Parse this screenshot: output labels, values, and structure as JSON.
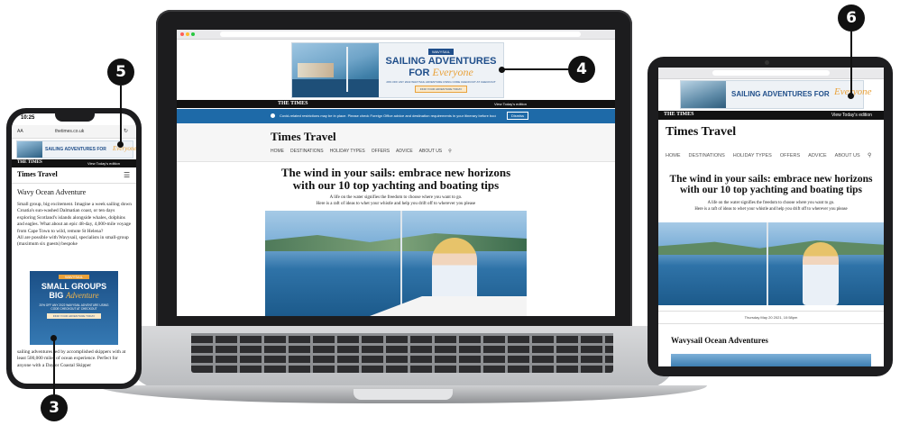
{
  "callouts": {
    "c3": "3",
    "c4": "4",
    "c5": "5",
    "c6": "6"
  },
  "ad": {
    "title_line1": "SAILING ADVENTURES",
    "title_line2_a": "FOR",
    "title_line2_b": "Everyone",
    "brand": "WAVYSAIL",
    "promo": "20% OFF ANY 2022 WAVYSAIL ADVENTURE USING CODE CHECKOUT AT CHECKOUT",
    "cta": "FIND YOUR ADVENTURE TODAY"
  },
  "site": {
    "masthead": "THE TIMES",
    "todays_edition": "View Today's edition",
    "notice": "Covid-related restrictions may be in place. Please check Foreign Office advice and destination requirements in your itinerary before booking.",
    "dismiss": "Dismiss",
    "section_title": "Times Travel",
    "nav": [
      "HOME",
      "DESTINATIONS",
      "HOLIDAY TYPES",
      "OFFERS",
      "ADVICE",
      "ABOUT US"
    ],
    "headline_1": "The wind in your sails: embrace new horizons",
    "headline_2": "with our 10 top yachting and boating tips",
    "standfirst_1": "A life on the water signifies the freedom to choose where you want to go.",
    "standfirst_2": "Here is a raft of ideas to whet your whistle and help you drift off to wherever you please",
    "dateline": "Thursday May 20 2021, 10:58pm",
    "subhead": "Wavysail Ocean Adventures"
  },
  "phone": {
    "time": "10:25",
    "font_control": "AA",
    "url": "thetimes.co.uk",
    "ad_text": "SAILING ADVENTURES FOR",
    "ad_script": "Everyone",
    "article_title": "Wavy Ocean Adventure",
    "body_1": "Small group, big excitement. Imagine a week sailing down Croatia's sun-washed Dalmatian coast, or ten days exploring Scotland's islands alongside whales, dolphins and eagles. What about an epic 48-day, 4,000-mile voyage from Cape Town to wild, remote St Helena?",
    "body_2": "All are possible with Wavysail, specialists in small-group (maximum six guests) bespoke",
    "inline_ad_brand": "WAVYSAIL",
    "inline_ad_1": "SMALL GROUPS",
    "inline_ad_2": "BIG",
    "inline_ad_script": "Adventure",
    "inline_ad_promo": "20% OFF ANY 2022 WAVYSAIL ADVENTURE USING CODE CHECKOUT AT CHECKOUT",
    "inline_ad_cta": "FIND YOUR ADVENTURE TODAY",
    "body_3": "sailing adventures led by accomplished skippers with at least 500,000 miles of ocean experience. Perfect for anyone with a Day or Coastal Skipper"
  },
  "tablet": {
    "ad_text": "SAILING ADVENTURES FOR",
    "ad_script": "Everyone"
  },
  "colors": {
    "accent_blue": "#1f4e8a",
    "notice_blue": "#1e6aa8",
    "masthead_bg": "#121212"
  }
}
